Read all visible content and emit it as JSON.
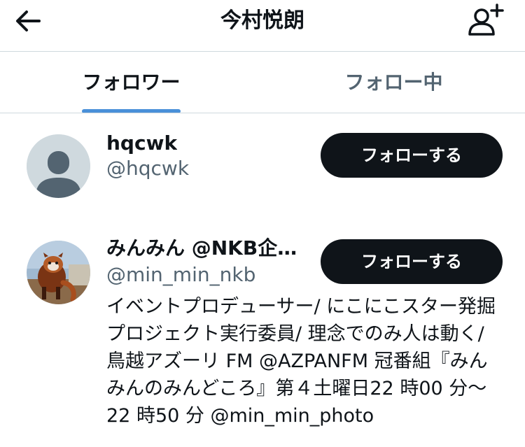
{
  "header": {
    "title": "今村悦朗",
    "back_icon": "arrow-left-icon",
    "add_user_icon": "person-add-icon"
  },
  "tabs": [
    {
      "label": "フォロワー",
      "active": true
    },
    {
      "label": "フォロー中",
      "active": false
    }
  ],
  "users": [
    {
      "name": "hqcwk",
      "handle": "@hqcwk",
      "button_label": "フォローする",
      "avatar": "default-avatar"
    },
    {
      "name": "みんみん @NKB企画…",
      "handle": "@min_min_nkb",
      "button_label": "フォローする",
      "avatar": "red-panda-photo",
      "bio": "イベントプロデューサー/ にこにこスター発掘プロジェクト実行委員/ 理念でのみ人は動く/ 鳥越アズーリ FM @AZPANFM 冠番組『みんみんのみんどころ』第４土曜日22 時00 分〜22 時50 分 @min_min_photo"
    }
  ],
  "colors": {
    "tab_indicator": "#4a90d9",
    "button_bg": "#0f1419",
    "secondary_text": "#536471",
    "divider": "#cfd9de"
  }
}
